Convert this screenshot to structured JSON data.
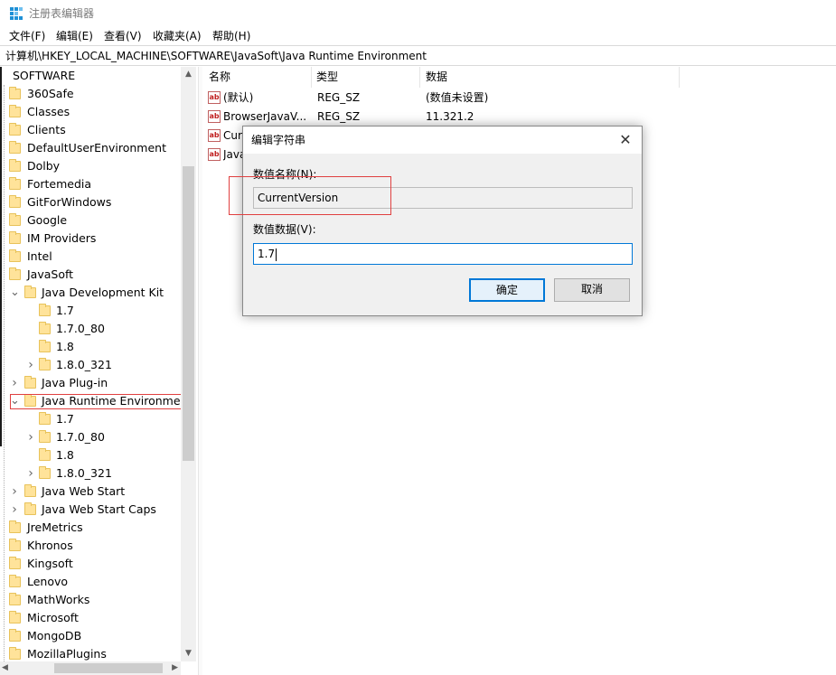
{
  "window": {
    "title": "注册表编辑器",
    "icon": "regedit-icon"
  },
  "menu": [
    "文件(F)",
    "编辑(E)",
    "查看(V)",
    "收藏夹(A)",
    "帮助(H)"
  ],
  "address": "计算机\\HKEY_LOCAL_MACHINE\\SOFTWARE\\JavaSoft\\Java Runtime Environment",
  "tree": {
    "root": "SOFTWARE",
    "items": [
      {
        "label": "360Safe"
      },
      {
        "label": "Classes"
      },
      {
        "label": "Clients"
      },
      {
        "label": "DefaultUserEnvironment"
      },
      {
        "label": "Dolby"
      },
      {
        "label": "Fortemedia"
      },
      {
        "label": "GitForWindows"
      },
      {
        "label": "Google"
      },
      {
        "label": "IM Providers"
      },
      {
        "label": "Intel"
      },
      {
        "label": "JavaSoft"
      },
      {
        "label": "Java Development Kit"
      },
      {
        "label": "1.7"
      },
      {
        "label": "1.7.0_80"
      },
      {
        "label": "1.8"
      },
      {
        "label": "1.8.0_321"
      },
      {
        "label": "Java Plug-in"
      },
      {
        "label": "Java Runtime Environment",
        "selected": true
      },
      {
        "label": "1.7"
      },
      {
        "label": "1.7.0_80"
      },
      {
        "label": "1.8"
      },
      {
        "label": "1.8.0_321"
      },
      {
        "label": "Java Web Start"
      },
      {
        "label": "Java Web Start Caps"
      },
      {
        "label": "JreMetrics"
      },
      {
        "label": "Khronos"
      },
      {
        "label": "Kingsoft"
      },
      {
        "label": "Lenovo"
      },
      {
        "label": "MathWorks"
      },
      {
        "label": "Microsoft"
      },
      {
        "label": "MongoDB"
      },
      {
        "label": "MozillaPlugins"
      }
    ]
  },
  "list": {
    "columns": [
      "名称",
      "类型",
      "数据"
    ],
    "rows": [
      {
        "name": "(默认)",
        "type": "REG_SZ",
        "data": "(数值未设置)"
      },
      {
        "name": "BrowserJavaV...",
        "type": "REG_SZ",
        "data": "11.321.2"
      },
      {
        "name": "Cur",
        "type": "",
        "data": ""
      },
      {
        "name": "Java",
        "type": "",
        "data": ""
      }
    ],
    "icon_text": "ab"
  },
  "dialog": {
    "title": "编辑字符串",
    "name_label": "数值名称(N):",
    "name_value": "CurrentVersion",
    "data_label": "数值数据(V):",
    "data_value": "1.7",
    "ok_label": "确定",
    "cancel_label": "取消"
  },
  "colors": {
    "accent": "#0078d7",
    "highlight_box": "#e04040",
    "folder": "#ffe39a"
  }
}
